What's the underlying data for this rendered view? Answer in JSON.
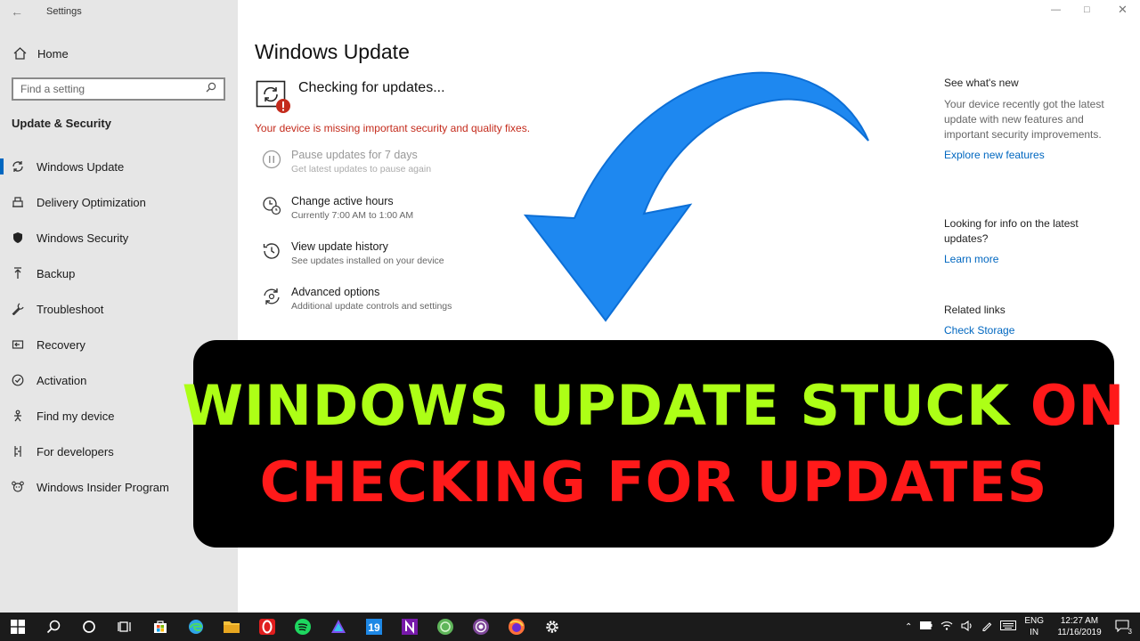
{
  "app": {
    "title": "Settings"
  },
  "sidebar": {
    "home_label": "Home",
    "search_placeholder": "Find a setting",
    "section_title": "Update & Security",
    "items": [
      {
        "label": "Windows Update",
        "icon": "sync-icon",
        "active": true
      },
      {
        "label": "Delivery Optimization",
        "icon": "delivery-icon"
      },
      {
        "label": "Windows Security",
        "icon": "shield-icon"
      },
      {
        "label": "Backup",
        "icon": "backup-icon"
      },
      {
        "label": "Troubleshoot",
        "icon": "wrench-icon"
      },
      {
        "label": "Recovery",
        "icon": "recovery-icon"
      },
      {
        "label": "Activation",
        "icon": "check-circle-icon"
      },
      {
        "label": "Find my device",
        "icon": "person-location-icon"
      },
      {
        "label": "For developers",
        "icon": "developer-icon"
      },
      {
        "label": "Windows Insider Program",
        "icon": "insider-icon"
      }
    ]
  },
  "main": {
    "title": "Windows Update",
    "status": "Checking for updates...",
    "warning": "Your device is missing important security and quality fixes.",
    "options": [
      {
        "title": "Pause updates for 7 days",
        "subtitle": "Get latest updates to pause again",
        "icon": "pause-icon",
        "disabled": true
      },
      {
        "title": "Change active hours",
        "subtitle": "Currently 7:00 AM to 1:00 AM",
        "icon": "clock-icon"
      },
      {
        "title": "View update history",
        "subtitle": "See updates installed on your device",
        "icon": "history-icon"
      },
      {
        "title": "Advanced options",
        "subtitle": "Additional update controls and settings",
        "icon": "advanced-sync-icon"
      }
    ]
  },
  "right": {
    "whats_new_heading": "See what's new",
    "whats_new_text": "Your device recently got the latest update with new features and important security improvements.",
    "whats_new_link": "Explore new features",
    "info_heading": "Looking for info on the latest updates?",
    "info_link": "Learn more",
    "related_heading": "Related links",
    "related_link": "Check Storage"
  },
  "banner": {
    "line1_green": "WINDOWS UPDATE STUCK",
    "line1_red": "ON",
    "line2_red": "CHECKING FOR UPDATES"
  },
  "taskbar": {
    "lang_top": "ENG",
    "lang_bottom": "IN",
    "time": "12:27 AM",
    "date": "11/16/2019",
    "notification_count": "3",
    "calendar_app_day": "19"
  },
  "colors": {
    "accent": "#0067c0",
    "warning": "#c42b1c",
    "banner_green": "#adff16",
    "banner_red": "#ff1a1a",
    "arrow": "#1e88f0"
  }
}
